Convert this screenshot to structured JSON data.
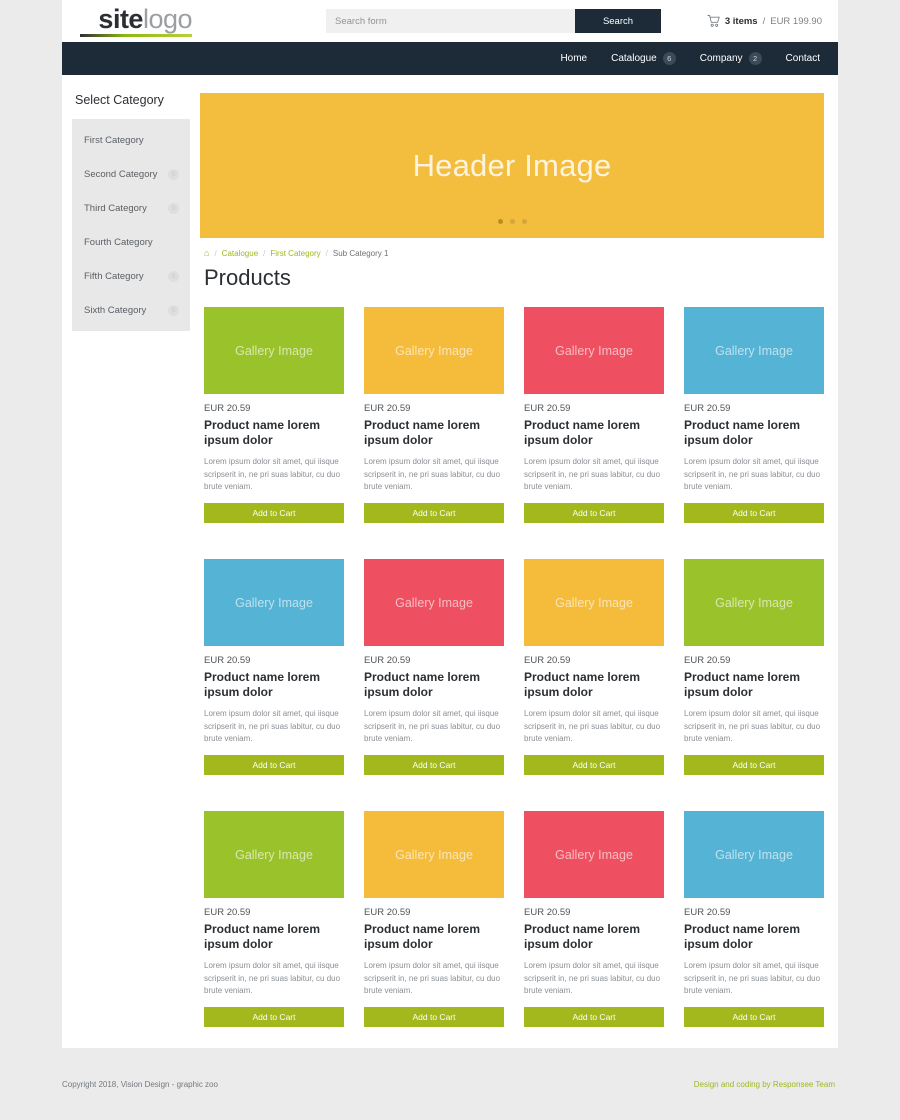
{
  "header": {
    "logo": {
      "bold_part": "site",
      "light_part": "logo"
    },
    "search": {
      "placeholder": "Search form",
      "value": "",
      "button_label": "Search"
    },
    "cart": {
      "icon": "cart-icon",
      "items_label": "3 items",
      "separator": "/",
      "total": "EUR 199.90"
    }
  },
  "nav": {
    "items": [
      {
        "label": "Home",
        "badge": null
      },
      {
        "label": "Catalogue",
        "badge": "6"
      },
      {
        "label": "Company",
        "badge": "2"
      },
      {
        "label": "Contact",
        "badge": null
      }
    ]
  },
  "sidebar": {
    "title": "Select Category",
    "items": [
      {
        "label": "First Category",
        "badge": null
      },
      {
        "label": "Second Category",
        "badge": "0"
      },
      {
        "label": "Third Category",
        "badge": "0"
      },
      {
        "label": "Fourth Category",
        "badge": null
      },
      {
        "label": "Fifth Category",
        "badge": "0"
      },
      {
        "label": "Sixth Category",
        "badge": "0"
      }
    ]
  },
  "hero": {
    "text": "Header Image",
    "bg_color": "#f3bd3d",
    "dots": [
      {
        "active": true
      },
      {
        "active": false
      },
      {
        "active": false
      }
    ]
  },
  "breadcrumb": {
    "home_icon": "home-icon",
    "separator": "/",
    "items": [
      {
        "label": "Catalogue",
        "current": false
      },
      {
        "label": "First Category",
        "current": false
      },
      {
        "label": "Sub Category 1",
        "current": true
      }
    ]
  },
  "main": {
    "page_title": "Products",
    "product_defaults": {
      "thumb_text": "Gallery Image",
      "price": "EUR 20.59",
      "name": "Product name lorem ipsum dolor",
      "description": "Lorem ipsum dolor sit amet, qui iisque scripserit in, ne pri suas labitur, cu duo brute veniam.",
      "cart_button_label": "Add to Cart"
    },
    "products": [
      {
        "color": "#9ac22b",
        "price": "EUR 20.59",
        "name": "Product name lorem ipsum dolor",
        "description": "Lorem ipsum dolor sit amet, qui iisque scripserit in, ne pri suas labitur, cu duo brute veniam.",
        "cart_button_label": "Add to Cart",
        "thumb_text": "Gallery Image"
      },
      {
        "color": "#f5bc3c",
        "price": "EUR 20.59",
        "name": "Product name lorem ipsum dolor",
        "description": "Lorem ipsum dolor sit amet, qui iisque scripserit in, ne pri suas labitur, cu duo brute veniam.",
        "cart_button_label": "Add to Cart",
        "thumb_text": "Gallery Image"
      },
      {
        "color": "#ef5061",
        "price": "EUR 20.59",
        "name": "Product name lorem ipsum dolor",
        "description": "Lorem ipsum dolor sit amet, qui iisque scripserit in, ne pri suas labitur, cu duo brute veniam.",
        "cart_button_label": "Add to Cart",
        "thumb_text": "Gallery Image"
      },
      {
        "color": "#55b3d6",
        "price": "EUR 20.59",
        "name": "Product name lorem ipsum dolor",
        "description": "Lorem ipsum dolor sit amet, qui iisque scripserit in, ne pri suas labitur, cu duo brute veniam.",
        "cart_button_label": "Add to Cart",
        "thumb_text": "Gallery Image"
      },
      {
        "color": "#55b3d6",
        "price": "EUR 20.59",
        "name": "Product name lorem ipsum dolor",
        "description": "Lorem ipsum dolor sit amet, qui iisque scripserit in, ne pri suas labitur, cu duo brute veniam.",
        "cart_button_label": "Add to Cart",
        "thumb_text": "Gallery Image"
      },
      {
        "color": "#ef5061",
        "price": "EUR 20.59",
        "name": "Product name lorem ipsum dolor",
        "description": "Lorem ipsum dolor sit amet, qui iisque scripserit in, ne pri suas labitur, cu duo brute veniam.",
        "cart_button_label": "Add to Cart",
        "thumb_text": "Gallery Image"
      },
      {
        "color": "#f5bc3c",
        "price": "EUR 20.59",
        "name": "Product name lorem ipsum dolor",
        "description": "Lorem ipsum dolor sit amet, qui iisque scripserit in, ne pri suas labitur, cu duo brute veniam.",
        "cart_button_label": "Add to Cart",
        "thumb_text": "Gallery Image"
      },
      {
        "color": "#9ac22b",
        "price": "EUR 20.59",
        "name": "Product name lorem ipsum dolor",
        "description": "Lorem ipsum dolor sit amet, qui iisque scripserit in, ne pri suas labitur, cu duo brute veniam.",
        "cart_button_label": "Add to Cart",
        "thumb_text": "Gallery Image"
      },
      {
        "color": "#9ac22b",
        "price": "EUR 20.59",
        "name": "Product name lorem ipsum dolor",
        "description": "Lorem ipsum dolor sit amet, qui iisque scripserit in, ne pri suas labitur, cu duo brute veniam.",
        "cart_button_label": "Add to Cart",
        "thumb_text": "Gallery Image"
      },
      {
        "color": "#f5bc3c",
        "price": "EUR 20.59",
        "name": "Product name lorem ipsum dolor",
        "description": "Lorem ipsum dolor sit amet, qui iisque scripserit in, ne pri suas labitur, cu duo brute veniam.",
        "cart_button_label": "Add to Cart",
        "thumb_text": "Gallery Image"
      },
      {
        "color": "#ef5061",
        "price": "EUR 20.59",
        "name": "Product name lorem ipsum dolor",
        "description": "Lorem ipsum dolor sit amet, qui iisque scripserit in, ne pri suas labitur, cu duo brute veniam.",
        "cart_button_label": "Add to Cart",
        "thumb_text": "Gallery Image"
      },
      {
        "color": "#55b3d6",
        "price": "EUR 20.59",
        "name": "Product name lorem ipsum dolor",
        "description": "Lorem ipsum dolor sit amet, qui iisque scripserit in, ne pri suas labitur, cu duo brute veniam.",
        "cart_button_label": "Add to Cart",
        "thumb_text": "Gallery Image"
      }
    ]
  },
  "footer": {
    "copyright": "Copyright 2018, Vision Design - graphic zoo",
    "credit": "Design and coding by Responsee Team"
  },
  "colors": {
    "accent_green": "#a2b81c",
    "nav_dark": "#1d2b39",
    "page_bg": "#ebebeb",
    "sidebar_bg": "#e8e8e8"
  }
}
